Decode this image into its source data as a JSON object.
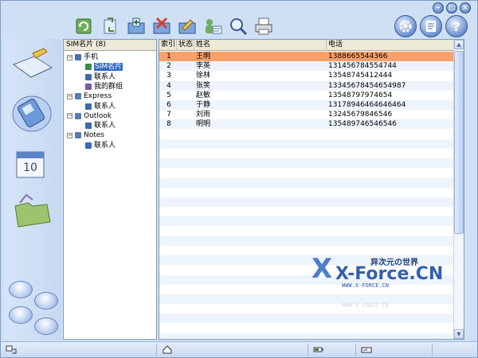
{
  "window": {
    "controls": [
      "minimize-icon",
      "maximize-icon",
      "close-icon"
    ]
  },
  "toolbar": {
    "buttons": [
      {
        "icon": "refresh-icon"
      },
      {
        "icon": "sync-icon"
      },
      {
        "icon": "add-contact-icon"
      },
      {
        "icon": "delete-contact-icon"
      },
      {
        "icon": "edit-contact-icon"
      },
      {
        "icon": "group-sms-icon"
      },
      {
        "icon": "search-icon"
      },
      {
        "icon": "print-icon"
      }
    ],
    "right_buttons": [
      "settings-icon",
      "notes-icon",
      "help-icon"
    ]
  },
  "nav": {
    "items": [
      {
        "icon": "message-icon"
      },
      {
        "icon": "phone-icon"
      },
      {
        "icon": "calendar-icon"
      },
      {
        "icon": "folder-icon"
      }
    ],
    "small_buttons": [
      "forward-icon",
      "backup-icon",
      "restore-icon",
      "transfer-icon"
    ]
  },
  "tree": {
    "header": "SIM名片 (8)",
    "nodes": [
      {
        "label": "手机",
        "level": 0,
        "expander": "−",
        "icon": "phone-device-icon",
        "selected": false
      },
      {
        "label": "SIM名片",
        "level": 1,
        "expander": "",
        "icon": "contact-card-icon",
        "selected": true
      },
      {
        "label": "联系人",
        "level": 1,
        "expander": "",
        "icon": "contact-icon",
        "selected": false
      },
      {
        "label": "我的群组",
        "level": 1,
        "expander": "",
        "icon": "group-icon",
        "selected": false
      },
      {
        "label": "Express",
        "level": 0,
        "expander": "−",
        "icon": "computer-icon",
        "selected": false
      },
      {
        "label": "联系人",
        "level": 1,
        "expander": "",
        "icon": "contact-icon",
        "selected": false
      },
      {
        "label": "Outlook",
        "level": 0,
        "expander": "−",
        "icon": "computer-icon",
        "selected": false
      },
      {
        "label": "联系人",
        "level": 1,
        "expander": "",
        "icon": "contact-icon",
        "selected": false
      },
      {
        "label": "Notes",
        "level": 0,
        "expander": "−",
        "icon": "computer-icon",
        "selected": false
      },
      {
        "label": "联系人",
        "level": 1,
        "expander": "",
        "icon": "contact-icon",
        "selected": false
      }
    ]
  },
  "table": {
    "columns": [
      "索引",
      "状态",
      "姓名",
      "电话"
    ],
    "rows": [
      {
        "index": "1",
        "status": "",
        "name": "王明",
        "phone": "1388665544366",
        "selected": true
      },
      {
        "index": "2",
        "status": "",
        "name": "李英",
        "phone": "131456784554744",
        "selected": false
      },
      {
        "index": "3",
        "status": "",
        "name": "徐林",
        "phone": "13548745412444",
        "selected": false
      },
      {
        "index": "4",
        "status": "",
        "name": "张笑",
        "phone": "13345678454654987",
        "selected": false
      },
      {
        "index": "5",
        "status": "",
        "name": "赵敏",
        "phone": "13548797974654",
        "selected": false
      },
      {
        "index": "6",
        "status": "",
        "name": "于静",
        "phone": "13178946464646464",
        "selected": false
      },
      {
        "index": "7",
        "status": "",
        "name": "刘雨",
        "phone": "13245679846546",
        "selected": false
      },
      {
        "index": "8",
        "status": "",
        "name": "明明",
        "phone": "135489746546546",
        "selected": false
      }
    ]
  },
  "watermark": {
    "logo": "X-Force.CN",
    "tagline": "异次元の世界",
    "url": "WWW.X-FORCE.CN"
  },
  "status_bar": {
    "icons": [
      "connection-icon",
      "home-icon",
      "battery-icon",
      "signal-icon"
    ]
  },
  "colors": {
    "selection_row": "#f7a06a",
    "tree_selection": "#316ac5",
    "frame": "#cfe0f5"
  }
}
